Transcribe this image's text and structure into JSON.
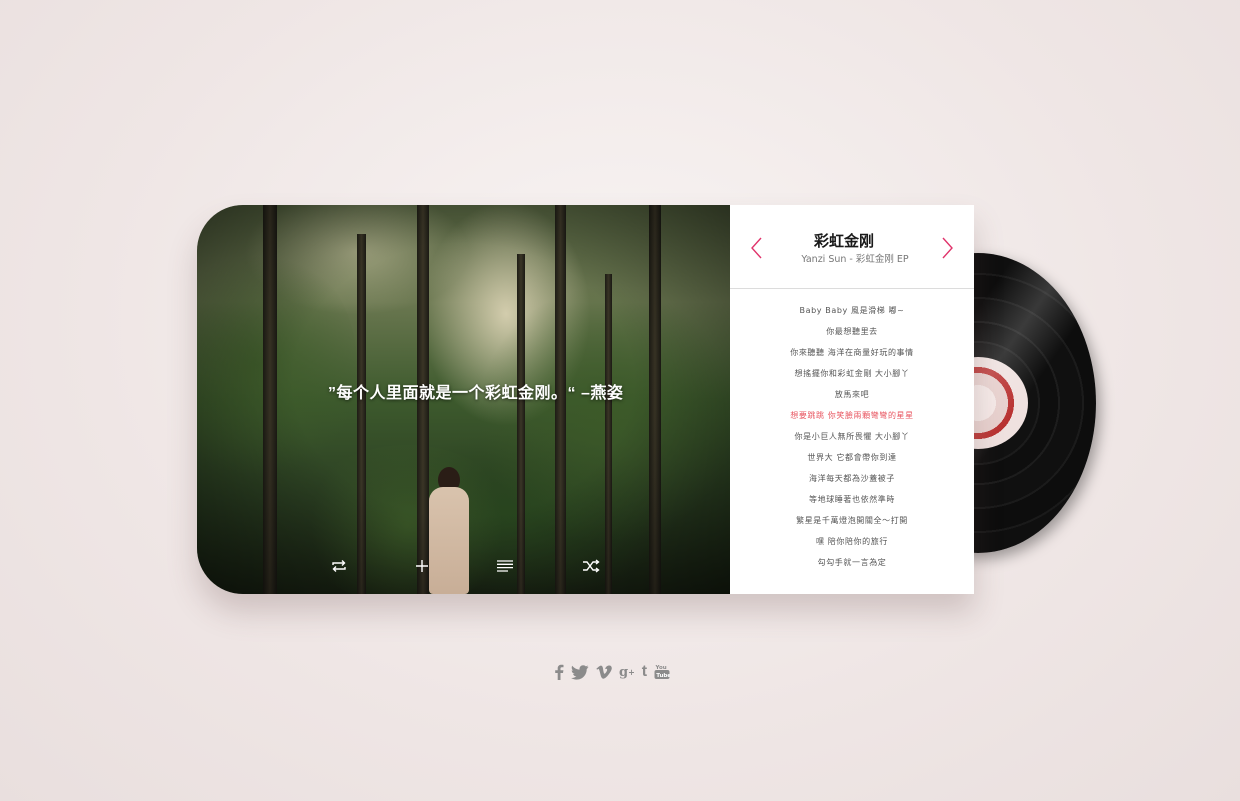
{
  "player": {
    "quote": "”每个人里面就是一个彩虹金刚。“ –燕姿",
    "controls": [
      {
        "name": "repeat",
        "icon": "repeat-icon"
      },
      {
        "name": "add",
        "icon": "plus-icon"
      },
      {
        "name": "playlist",
        "icon": "list-icon"
      },
      {
        "name": "shuffle",
        "icon": "shuffle-icon"
      }
    ]
  },
  "song": {
    "title": "彩虹金刚",
    "subtitle": "Yanzi Sun - 彩虹金刚 EP"
  },
  "lyrics": {
    "active_index": 5,
    "lines": [
      "Baby Baby 風是滑梯 嘟~",
      "你最想聽里去",
      "你來聽聽 海洋在商量好玩的事情",
      "想搖擺你和彩虹金剛 大小腳丫",
      "放馬來吧",
      "想要跳跳 你笑臉兩顆彎彎的星星",
      "你是小巨人無所畏懼 大小腳丫",
      "世界大 它都會帶你到達",
      "海洋每天都為沙蓋被子",
      "等地球睡著也依然準時",
      "繁星是千萬燈泡開關全～打開",
      "嘿 陪你陪你的旅行",
      "勾勾手就一言為定"
    ]
  },
  "colors": {
    "accent": "#e8545f",
    "nav_arrow": "#e0336b",
    "icon_gray": "#8b8b8b"
  },
  "social": [
    {
      "name": "facebook-icon",
      "glyph": "f"
    },
    {
      "name": "twitter-icon",
      "glyph": "t"
    },
    {
      "name": "vimeo-icon",
      "glyph": "v"
    },
    {
      "name": "google-plus-icon",
      "glyph": "g+"
    },
    {
      "name": "tumblr-icon",
      "glyph": "t"
    },
    {
      "name": "youtube-icon",
      "glyph": "You"
    }
  ]
}
